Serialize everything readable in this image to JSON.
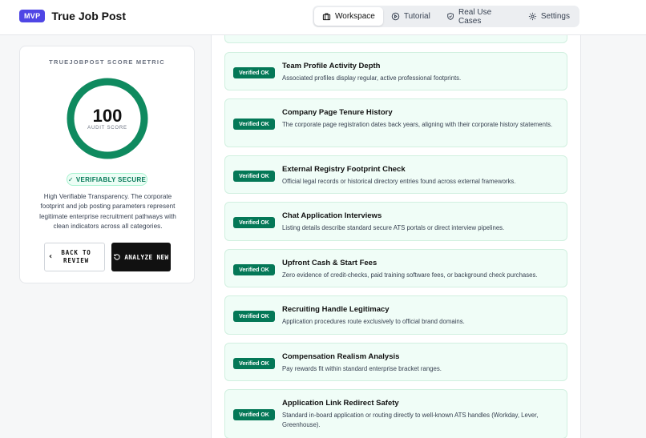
{
  "header": {
    "badge": "MVP",
    "title": "True Job Post",
    "tabs": [
      {
        "label": "Workspace",
        "icon": "briefcase-icon",
        "active": true
      },
      {
        "label": "Tutorial",
        "icon": "play-circle-icon",
        "active": false
      },
      {
        "label": "Real Use Cases",
        "icon": "shield-check-icon",
        "active": false
      },
      {
        "label": "Settings",
        "icon": "gear-icon",
        "active": false
      }
    ]
  },
  "score_card": {
    "label": "TRUEJOBPOST SCORE METRIC",
    "score": "100",
    "score_caption": "AUDIT SCORE",
    "score_fraction": 1.0,
    "status_badge": "VERIFIABLY SECURE",
    "description": "High Verifiable Transparency. The corporate footprint and job posting parameters represent legitimate enterprise recruitment pathways with clean indicators across all categories.",
    "back_button": "BACK TO REVIEW",
    "analyze_button": "ANALYZE NEW",
    "colors": {
      "ring": "#0f8a5f",
      "badge_bg": "#ecfdf5",
      "badge_text": "#047857"
    }
  },
  "checks": [
    {
      "status": "Verified OK",
      "title": "Team Profile Activity Depth",
      "description": "Associated profiles display regular, active professional footprints."
    },
    {
      "status": "Verified OK",
      "title": "Company Page Tenure History",
      "description": "The corporate page registration dates back years, aligning with their corporate history statements."
    },
    {
      "status": "Verified OK",
      "title": "External Registry Footprint Check",
      "description": "Official legal records or historical directory entries found across external frameworks."
    },
    {
      "status": "Verified OK",
      "title": "Chat Application Interviews",
      "description": "Listing details describe standard secure ATS portals or direct interview pipelines."
    },
    {
      "status": "Verified OK",
      "title": "Upfront Cash & Start Fees",
      "description": "Zero evidence of credit-checks, paid training software fees, or background check purchases."
    },
    {
      "status": "Verified OK",
      "title": "Recruiting Handle Legitimacy",
      "description": "Application procedures route exclusively to official brand domains."
    },
    {
      "status": "Verified OK",
      "title": "Compensation Realism Analysis",
      "description": "Pay rewards fit within standard enterprise bracket ranges."
    },
    {
      "status": "Verified OK",
      "title": "Application Link Redirect Safety",
      "description": "Standard in-board application or routing directly to well-known ATS handles (Workday, Lever, Greenhouse)."
    }
  ]
}
